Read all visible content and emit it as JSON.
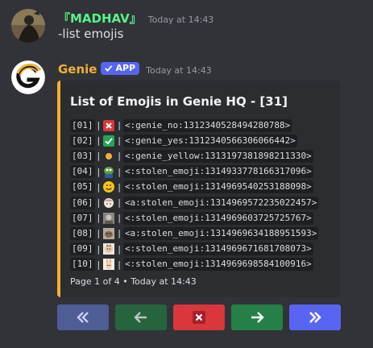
{
  "messages": [
    {
      "author": "『MADHAV』",
      "author_color": "#57f287",
      "timestamp": "Today at 14:43",
      "content": "-list emojis"
    },
    {
      "author": "Genie",
      "author_color": "#f0b132",
      "badge": "APP",
      "timestamp": "Today at 14:43",
      "embed": {
        "accent_color": "#f0b132",
        "title": "List of Emojis in Genie HQ - [31]",
        "rows": [
          {
            "index": "[01]",
            "emoji": "red-x-icon",
            "code": "<:genie_no:1312340528494280788>"
          },
          {
            "index": "[02]",
            "emoji": "green-check-icon",
            "code": "<:genie_yes:1312340566306066442>"
          },
          {
            "index": "[03]",
            "emoji": "yellow-dot-icon",
            "code": "<:genie_yellow:1313197381898211330>"
          },
          {
            "index": "[04]",
            "emoji": "pepe-icon",
            "code": "<:stolen_emoji:1314933778166317096>"
          },
          {
            "index": "[05]",
            "emoji": "smiley-icon",
            "code": "<:stolen_emoji:1314969540253188098>"
          },
          {
            "index": "[06]",
            "emoji": "anime-sticker-icon",
            "code": "<a:stolen_emoji:1314969572235022457>"
          },
          {
            "index": "[07]",
            "emoji": "gray-photo-icon",
            "code": "<:stolen_emoji:1314969603725725767>"
          },
          {
            "index": "[08]",
            "emoji": "animal-photo-icon",
            "code": "<a:stolen_emoji:1314969634188951593>"
          },
          {
            "index": "[09]",
            "emoji": "cartoon-icon",
            "code": "<:stolen_emoji:1314969671681708073>"
          },
          {
            "index": "[10]",
            "emoji": "cartoon-bunny-icon",
            "code": "<:stolen_emoji:1314969698584100916>"
          }
        ],
        "footer": "Page 1 of 4 • Today at 14:43"
      }
    }
  ],
  "buttons": [
    {
      "name": "first-page-button",
      "icon": "double-chevron-left-icon",
      "color": "#4e5d94"
    },
    {
      "name": "previous-page-button",
      "icon": "arrow-left-icon",
      "color": "#25643d"
    },
    {
      "name": "close-button",
      "icon": "close-icon",
      "color": "#da373c"
    },
    {
      "name": "next-page-button",
      "icon": "arrow-right-icon",
      "color": "#248046"
    },
    {
      "name": "last-page-button",
      "icon": "double-chevron-right-icon",
      "color": "#5865f2"
    }
  ]
}
